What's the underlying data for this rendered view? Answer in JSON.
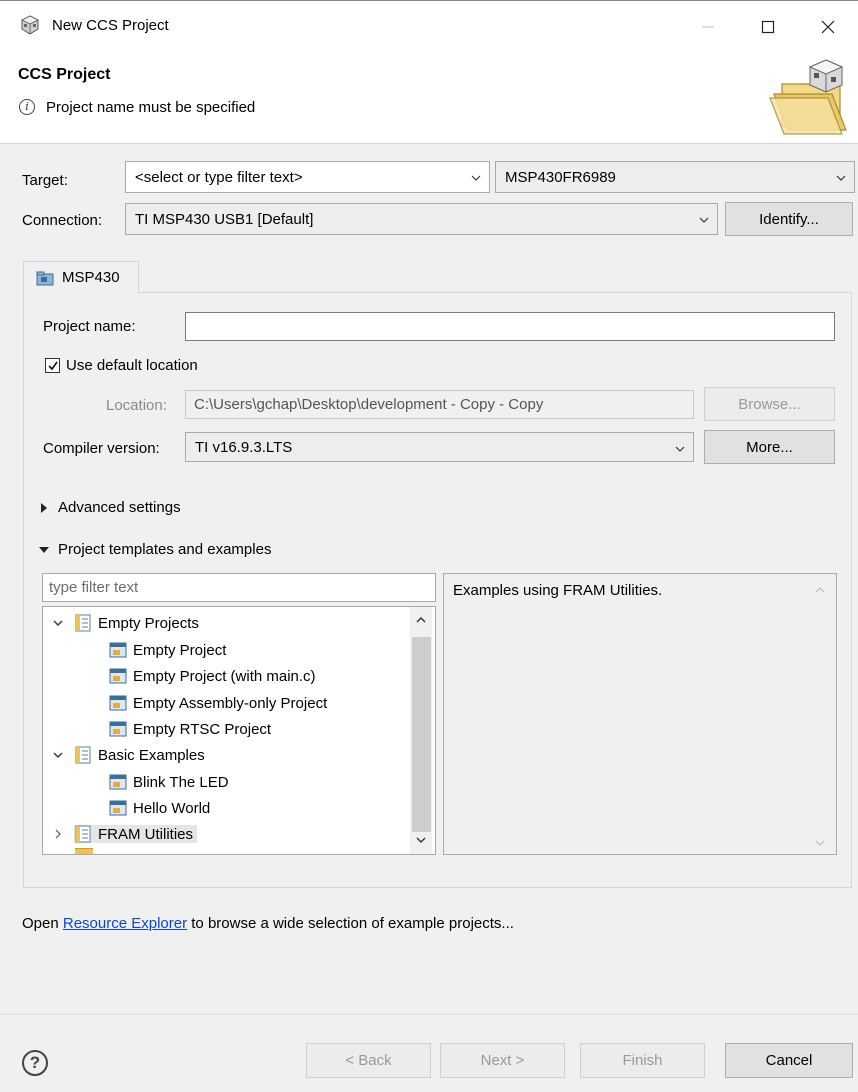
{
  "window": {
    "title": "New CCS Project"
  },
  "header": {
    "title": "CCS Project",
    "message": "Project name must be specified"
  },
  "target": {
    "label": "Target:",
    "filter_value": "<select or type filter text>",
    "device_value": "MSP430FR6989"
  },
  "connection": {
    "label": "Connection:",
    "value": "TI MSP430 USB1 [Default]",
    "identify_label": "Identify..."
  },
  "tab": {
    "label": "MSP430"
  },
  "project": {
    "name_label": "Project name:",
    "name_value": "",
    "use_default_label": "Use default location",
    "use_default_checked": true,
    "location_label": "Location:",
    "location_value": "C:\\Users\\gchap\\Desktop\\development - Copy - Copy",
    "browse_label": "Browse...",
    "compiler_label": "Compiler version:",
    "compiler_value": "TI v16.9.3.LTS",
    "more_label": "More..."
  },
  "sections": {
    "advanced": "Advanced settings",
    "templates": "Project templates and examples"
  },
  "templates": {
    "filter_placeholder": "type filter text",
    "tree": [
      {
        "label": "Empty Projects",
        "level": 0,
        "expanded": true
      },
      {
        "label": "Empty Project",
        "level": 1
      },
      {
        "label": "Empty Project (with main.c)",
        "level": 1
      },
      {
        "label": "Empty Assembly-only Project",
        "level": 1
      },
      {
        "label": "Empty RTSC Project",
        "level": 1
      },
      {
        "label": "Basic Examples",
        "level": 0,
        "expanded": true
      },
      {
        "label": "Blink The LED",
        "level": 1
      },
      {
        "label": "Hello World",
        "level": 1
      },
      {
        "label": "FRAM Utilities",
        "level": 0,
        "expanded": false,
        "selected": true
      }
    ],
    "description": "Examples using FRAM Utilities."
  },
  "resource": {
    "prefix": "Open ",
    "link": "Resource Explorer",
    "suffix": " to browse a wide selection of example projects..."
  },
  "footer": {
    "back": "< Back",
    "next": "Next >",
    "finish": "Finish",
    "cancel": "Cancel"
  }
}
